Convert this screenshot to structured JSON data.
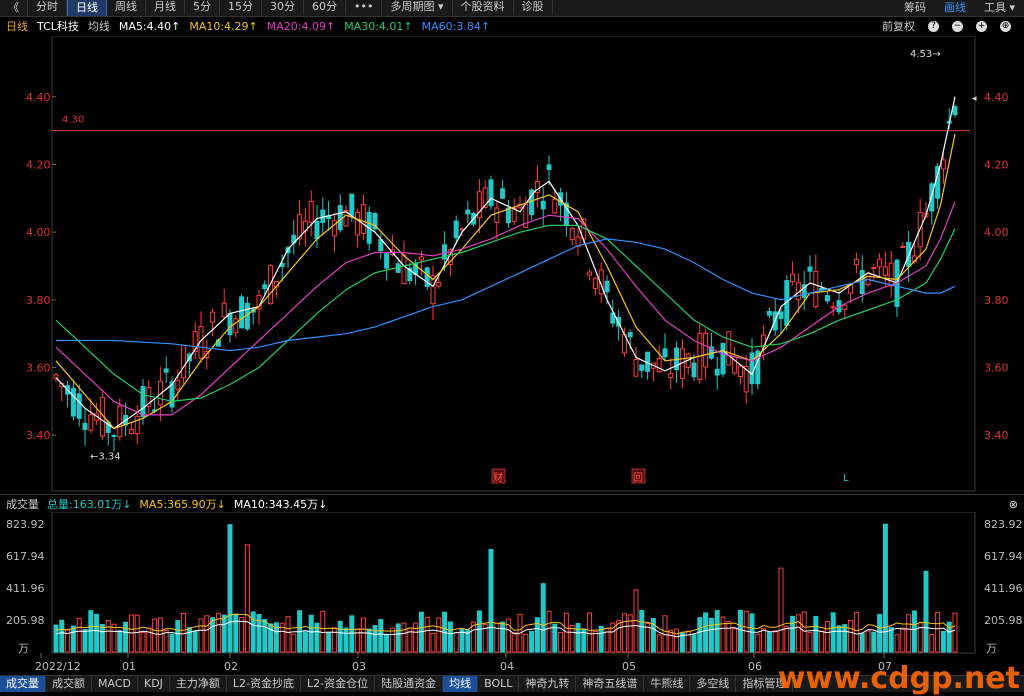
{
  "toolbar": {
    "back": "《",
    "tabs": [
      "分时",
      "日线",
      "周线",
      "月线",
      "5分",
      "15分",
      "30分",
      "60分",
      "•••",
      "多周期图 ▾",
      "个股资料",
      "诊股"
    ],
    "active": 1,
    "right": [
      "筹码",
      "画线",
      "工具 ▾"
    ],
    "right_active": 1
  },
  "ma_bar": {
    "period": "日线",
    "stock": "TCL科技",
    "avg": "均线",
    "items": [
      {
        "text": "MA5:4.40↑",
        "color": "#ffffff"
      },
      {
        "text": "MA10:4.29↑",
        "color": "#f5c518"
      },
      {
        "text": "MA20:4.09↑",
        "color": "#e040c0"
      },
      {
        "text": "MA30:4.01↑",
        "color": "#22cc66"
      },
      {
        "text": "MA60:3.84↑",
        "color": "#2f8fff"
      }
    ],
    "fq": "前复权"
  },
  "vol_bar": {
    "title": "成交量",
    "items": [
      {
        "text": "总量:163.01万↓",
        "color": "#20c8c8"
      },
      {
        "text": "MA5:365.90万↓",
        "color": "#f5c518"
      },
      {
        "text": "MA10:343.45万↓",
        "color": "#ffffff"
      }
    ]
  },
  "chart_data": {
    "type": "candlestick",
    "ylim": [
      3.25,
      4.55
    ],
    "yticks": [
      "4.40",
      "4.20",
      "4.00",
      "3.80",
      "3.60",
      "3.40"
    ],
    "ref_line": {
      "value": 4.3,
      "label": "4.30"
    },
    "high_label": "4.53→",
    "low_label": "←3.34",
    "event_markers": [
      "财",
      "回",
      "L"
    ],
    "ma_series": [
      {
        "name": "MA5",
        "color": "#ffffff",
        "points": [
          [
            0,
            3.57
          ],
          [
            10,
            3.48
          ],
          [
            20,
            3.42
          ],
          [
            30,
            3.48
          ],
          [
            40,
            3.55
          ],
          [
            50,
            3.68
          ],
          [
            60,
            3.76
          ],
          [
            70,
            3.78
          ],
          [
            80,
            3.95
          ],
          [
            90,
            4.04
          ],
          [
            100,
            4.06
          ],
          [
            110,
            4.0
          ],
          [
            120,
            3.9
          ],
          [
            130,
            3.84
          ],
          [
            140,
            4.0
          ],
          [
            150,
            4.1
          ],
          [
            160,
            4.06
          ],
          [
            165,
            4.12
          ],
          [
            170,
            4.15
          ],
          [
            180,
            4.02
          ],
          [
            190,
            3.8
          ],
          [
            200,
            3.63
          ],
          [
            210,
            3.59
          ],
          [
            220,
            3.63
          ],
          [
            230,
            3.65
          ],
          [
            240,
            3.58
          ],
          [
            250,
            3.78
          ],
          [
            260,
            3.85
          ],
          [
            270,
            3.82
          ],
          [
            280,
            3.88
          ],
          [
            290,
            3.85
          ],
          [
            300,
            4.05
          ],
          [
            305,
            4.2
          ],
          [
            310,
            4.4
          ]
        ]
      },
      {
        "name": "MA10",
        "color": "#f5c518",
        "points": [
          [
            0,
            3.62
          ],
          [
            10,
            3.52
          ],
          [
            20,
            3.42
          ],
          [
            30,
            3.45
          ],
          [
            40,
            3.5
          ],
          [
            50,
            3.62
          ],
          [
            60,
            3.72
          ],
          [
            70,
            3.78
          ],
          [
            80,
            3.88
          ],
          [
            90,
            3.98
          ],
          [
            100,
            4.05
          ],
          [
            110,
            4.02
          ],
          [
            120,
            3.93
          ],
          [
            130,
            3.86
          ],
          [
            140,
            3.95
          ],
          [
            150,
            4.05
          ],
          [
            160,
            4.08
          ],
          [
            170,
            4.11
          ],
          [
            180,
            4.06
          ],
          [
            190,
            3.9
          ],
          [
            200,
            3.72
          ],
          [
            210,
            3.62
          ],
          [
            220,
            3.63
          ],
          [
            230,
            3.65
          ],
          [
            240,
            3.62
          ],
          [
            250,
            3.7
          ],
          [
            260,
            3.82
          ],
          [
            270,
            3.83
          ],
          [
            280,
            3.87
          ],
          [
            290,
            3.86
          ],
          [
            300,
            3.95
          ],
          [
            305,
            4.08
          ],
          [
            310,
            4.29
          ]
        ]
      },
      {
        "name": "MA20",
        "color": "#e040c0",
        "points": [
          [
            0,
            3.66
          ],
          [
            10,
            3.58
          ],
          [
            20,
            3.5
          ],
          [
            30,
            3.46
          ],
          [
            40,
            3.46
          ],
          [
            50,
            3.52
          ],
          [
            60,
            3.6
          ],
          [
            70,
            3.68
          ],
          [
            80,
            3.76
          ],
          [
            90,
            3.84
          ],
          [
            100,
            3.91
          ],
          [
            110,
            3.94
          ],
          [
            120,
            3.94
          ],
          [
            130,
            3.93
          ],
          [
            140,
            3.95
          ],
          [
            150,
            3.98
          ],
          [
            160,
            4.02
          ],
          [
            170,
            4.05
          ],
          [
            180,
            4.04
          ],
          [
            190,
            3.95
          ],
          [
            200,
            3.84
          ],
          [
            210,
            3.74
          ],
          [
            220,
            3.68
          ],
          [
            230,
            3.64
          ],
          [
            240,
            3.62
          ],
          [
            250,
            3.66
          ],
          [
            260,
            3.72
          ],
          [
            270,
            3.78
          ],
          [
            280,
            3.82
          ],
          [
            290,
            3.85
          ],
          [
            300,
            3.9
          ],
          [
            305,
            3.98
          ],
          [
            310,
            4.09
          ]
        ]
      },
      {
        "name": "MA30",
        "color": "#22cc66",
        "points": [
          [
            0,
            3.74
          ],
          [
            10,
            3.66
          ],
          [
            20,
            3.58
          ],
          [
            30,
            3.52
          ],
          [
            40,
            3.5
          ],
          [
            50,
            3.51
          ],
          [
            60,
            3.55
          ],
          [
            70,
            3.6
          ],
          [
            80,
            3.68
          ],
          [
            90,
            3.76
          ],
          [
            100,
            3.83
          ],
          [
            110,
            3.88
          ],
          [
            120,
            3.9
          ],
          [
            130,
            3.92
          ],
          [
            140,
            3.94
          ],
          [
            150,
            3.97
          ],
          [
            160,
            4.0
          ],
          [
            170,
            4.02
          ],
          [
            180,
            4.02
          ],
          [
            190,
            3.98
          ],
          [
            200,
            3.9
          ],
          [
            210,
            3.82
          ],
          [
            220,
            3.74
          ],
          [
            230,
            3.69
          ],
          [
            240,
            3.66
          ],
          [
            250,
            3.67
          ],
          [
            260,
            3.7
          ],
          [
            270,
            3.74
          ],
          [
            280,
            3.77
          ],
          [
            290,
            3.8
          ],
          [
            300,
            3.85
          ],
          [
            305,
            3.92
          ],
          [
            310,
            4.01
          ]
        ]
      },
      {
        "name": "MA60",
        "color": "#2f8fff",
        "points": [
          [
            0,
            3.68
          ],
          [
            20,
            3.68
          ],
          [
            40,
            3.67
          ],
          [
            50,
            3.66
          ],
          [
            60,
            3.65
          ],
          [
            70,
            3.66
          ],
          [
            80,
            3.68
          ],
          [
            90,
            3.69
          ],
          [
            100,
            3.7
          ],
          [
            110,
            3.72
          ],
          [
            120,
            3.75
          ],
          [
            130,
            3.78
          ],
          [
            140,
            3.8
          ],
          [
            150,
            3.84
          ],
          [
            160,
            3.88
          ],
          [
            170,
            3.92
          ],
          [
            180,
            3.96
          ],
          [
            190,
            3.98
          ],
          [
            200,
            3.97
          ],
          [
            210,
            3.95
          ],
          [
            220,
            3.91
          ],
          [
            230,
            3.86
          ],
          [
            240,
            3.82
          ],
          [
            250,
            3.8
          ],
          [
            260,
            3.82
          ],
          [
            270,
            3.84
          ],
          [
            280,
            3.86
          ],
          [
            290,
            3.84
          ],
          [
            300,
            3.82
          ],
          [
            305,
            3.82
          ],
          [
            310,
            3.84
          ]
        ]
      }
    ],
    "vol_ylim": [
      0,
      850
    ],
    "vol_yticks": [
      "823.92",
      "617.94",
      "411.96",
      "205.98"
    ],
    "vol_unit": "万",
    "x_labels": [
      "2022/12",
      "01",
      "02",
      "03",
      "04",
      "05",
      "06",
      "07"
    ]
  },
  "bottom_tabs": [
    "成交量",
    "成交额",
    "MACD",
    "KDJ",
    "主力净额",
    "L2-资金抄底",
    "L2-资金仓位",
    "陆股通资金",
    "均线",
    "BOLL",
    "神奇九转",
    "神奇五线谱",
    "牛熊线",
    "多空线",
    "指标管理"
  ],
  "bottom_active": [
    0,
    8
  ],
  "watermark": "www.cdgp.net"
}
